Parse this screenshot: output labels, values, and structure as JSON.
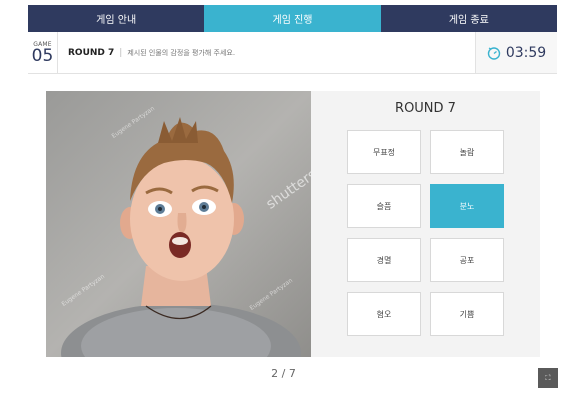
{
  "tabs": [
    {
      "label": "게임 안내",
      "active": false
    },
    {
      "label": "게임 진행",
      "active": true
    },
    {
      "label": "게임 종료",
      "active": false
    }
  ],
  "header": {
    "game_label": "GAME",
    "game_number": "05",
    "round_label": "ROUND 7",
    "separator": "|",
    "instruction": "제시된 인물의 감정을 평가해 주세요.",
    "timer": "03:59"
  },
  "photo": {
    "watermark_1": "Eugene Partyzan",
    "watermark_2": "shutterstock",
    "watermark_3": "Eugene Partyzan",
    "watermark_4": "Eugene Partyzan"
  },
  "panel": {
    "title": "ROUND 7",
    "options": [
      "무표정",
      "놀람",
      "슬픔",
      "분노",
      "경멸",
      "공포",
      "혐오",
      "기쁨"
    ],
    "selected_index": 3
  },
  "pager": {
    "text": "2 / 7"
  },
  "colors": {
    "navy": "#2f3a5f",
    "accent": "#3ab3cf"
  }
}
